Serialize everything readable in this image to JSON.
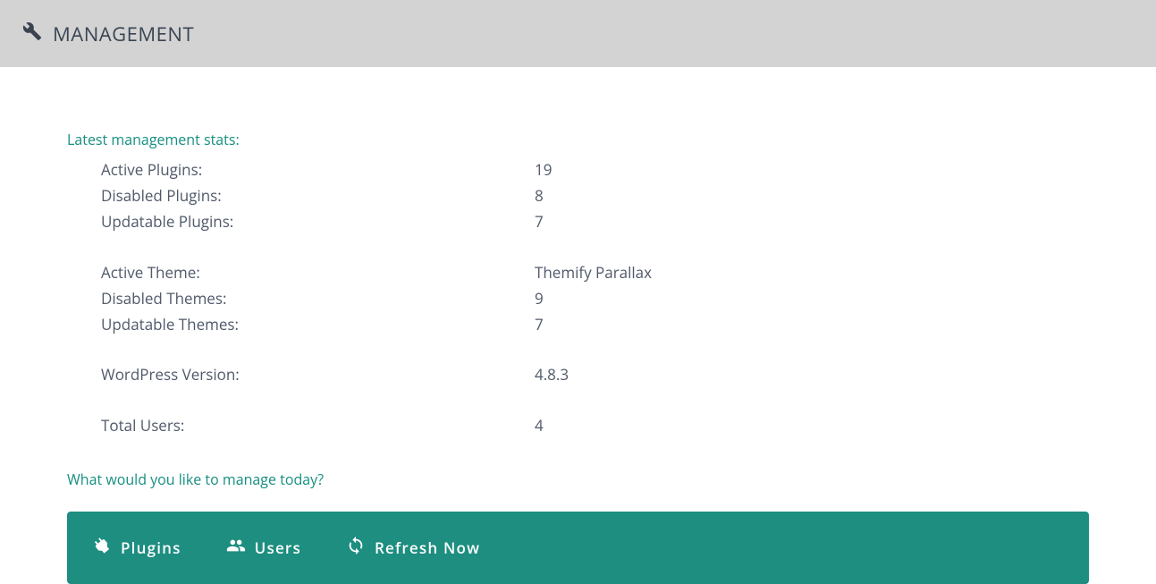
{
  "header": {
    "title": "MANAGEMENT"
  },
  "sections": {
    "stats_label": "Latest management stats:",
    "prompt_label": "What would you like to manage today?"
  },
  "stats": {
    "active_plugins": {
      "label": "Active Plugins:",
      "value": "19"
    },
    "disabled_plugins": {
      "label": "Disabled Plugins:",
      "value": "8"
    },
    "updatable_plugins": {
      "label": "Updatable Plugins:",
      "value": "7"
    },
    "active_theme": {
      "label": "Active Theme:",
      "value": "Themify Parallax"
    },
    "disabled_themes": {
      "label": "Disabled Themes:",
      "value": "9"
    },
    "updatable_themes": {
      "label": "Updatable Themes:",
      "value": "7"
    },
    "wordpress_version": {
      "label": "WordPress Version:",
      "value": "4.8.3"
    },
    "total_users": {
      "label": "Total Users:",
      "value": "4"
    }
  },
  "actions": {
    "plugins": "Plugins",
    "users": "Users",
    "refresh": "Refresh Now"
  }
}
